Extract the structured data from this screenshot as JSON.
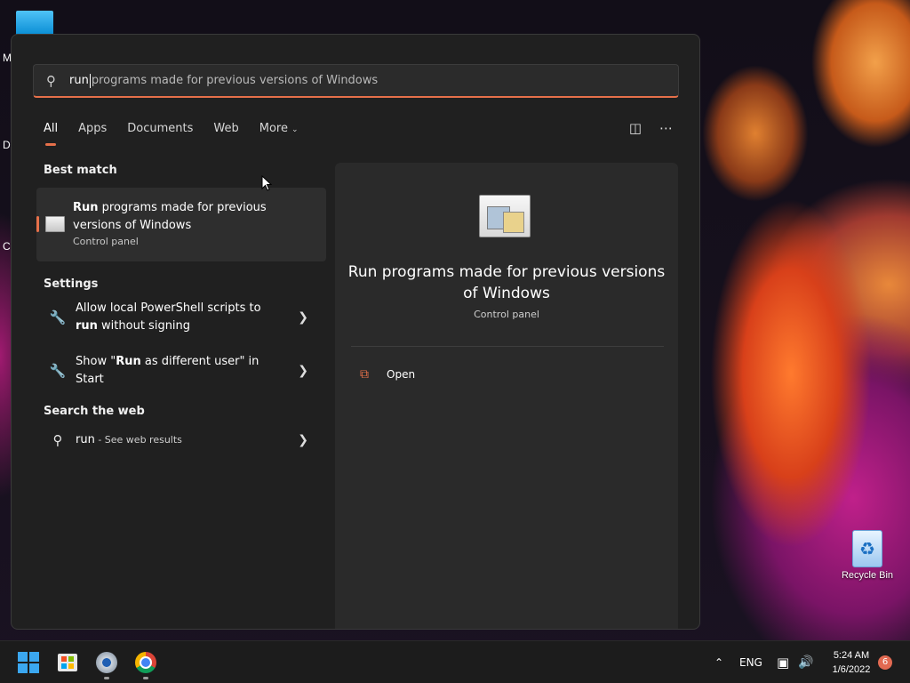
{
  "desktop": {
    "edge_labels": [
      "M",
      "Da",
      "Cl"
    ],
    "recycle_bin_label": "Recycle Bin"
  },
  "search": {
    "typed": "run",
    "suggestion": "programs made for previous versions of Windows"
  },
  "tabs": [
    "All",
    "Apps",
    "Documents",
    "Web",
    "More"
  ],
  "sections": {
    "best_match": "Best match",
    "settings": "Settings",
    "web": "Search the web"
  },
  "best_match": {
    "title_bold": "Run",
    "title_rest": " programs made for previous versions of Windows",
    "subtitle": "Control panel"
  },
  "settings_items": [
    {
      "pre": "Allow local PowerShell scripts to ",
      "bold": "run",
      "post": " without signing"
    },
    {
      "pre": "Show \"",
      "bold": "Run",
      "post": " as different user\" in Start"
    }
  ],
  "web_item": {
    "query": "run",
    "suffix": " - See web results"
  },
  "preview": {
    "title": "Run programs made for previous versions of Windows",
    "subtitle": "Control panel",
    "action_open": "Open"
  },
  "taskbar": {
    "language": "ENG",
    "time": "5:24 AM",
    "date": "1/6/2022",
    "notification_count": "6"
  },
  "colors": {
    "accent": "#e6704a",
    "flyout_bg": "#202020",
    "preview_bg": "#2a2a2a",
    "win_blue": "#3ba7f0"
  },
  "icons": [
    "search-icon",
    "feedback-icon",
    "more-options-icon",
    "control-panel-icon",
    "settings-wrench-icon",
    "chevron-right-icon",
    "open-external-icon",
    "windows-start-icon",
    "store-icon",
    "settings-gear-icon",
    "chrome-icon",
    "chevron-up-icon",
    "network-icon",
    "volume-icon",
    "recycle-bin-icon"
  ]
}
